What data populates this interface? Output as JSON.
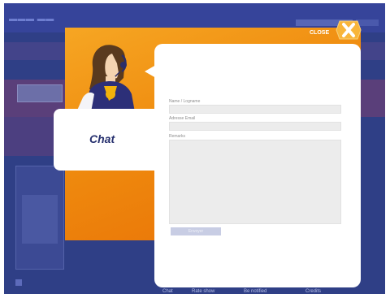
{
  "modal": {
    "title": "Chat",
    "close_label": "CLOSE",
    "fields": [
      {
        "label": "Name / Logname",
        "value": ""
      },
      {
        "label": "Adresse Email",
        "value": ""
      },
      {
        "label": "Remarks",
        "value": ""
      }
    ],
    "submit_label": "Envoyer"
  },
  "bottom_nav": {
    "items": [
      "Chat",
      "Rate show",
      "Be notified",
      "Credits"
    ]
  },
  "colors": {
    "modal_accent": "#ef8a0e",
    "background_page": "#2f3f86",
    "chat_label": "#26306e"
  },
  "icons": [
    "close-icon",
    "customer-service-agent-icon"
  ]
}
